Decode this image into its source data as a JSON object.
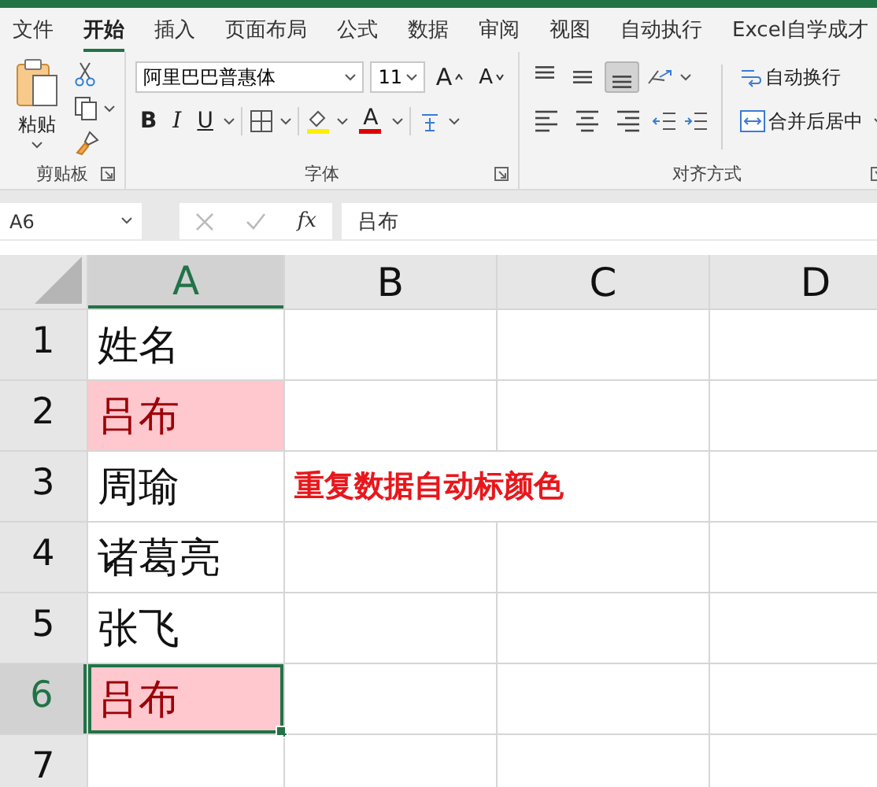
{
  "tabs": [
    {
      "label": "文件",
      "selected": false
    },
    {
      "label": "开始",
      "selected": true
    },
    {
      "label": "插入",
      "selected": false
    },
    {
      "label": "页面布局",
      "selected": false
    },
    {
      "label": "公式",
      "selected": false
    },
    {
      "label": "数据",
      "selected": false
    },
    {
      "label": "审阅",
      "selected": false
    },
    {
      "label": "视图",
      "selected": false
    },
    {
      "label": "自动执行",
      "selected": false
    },
    {
      "label": "Excel自学成才",
      "selected": false
    }
  ],
  "ribbon": {
    "clipboard": {
      "paste": "粘贴",
      "label": "剪贴板"
    },
    "font": {
      "name": "阿里巴巴普惠体",
      "size": "11",
      "grow": "A",
      "shrink": "A",
      "bold": "B",
      "italic": "I",
      "underline": "U",
      "font_color": "A",
      "label": "字体"
    },
    "alignment": {
      "vertical": [
        {
          "kind": "top",
          "selected": false
        },
        {
          "kind": "middle",
          "selected": false
        },
        {
          "kind": "bottom",
          "selected": true
        }
      ],
      "horizontal": [
        {
          "kind": "left",
          "selected": false
        },
        {
          "kind": "center",
          "selected": false
        },
        {
          "kind": "right",
          "selected": false
        }
      ],
      "wrap": "自动换行",
      "merge": "合并后居中",
      "label": "对齐方式"
    }
  },
  "formula_bar": {
    "name_box": "A6",
    "fx": "fx",
    "value": "吕布"
  },
  "sheet": {
    "columns": [
      {
        "label": "A",
        "selected": true
      },
      {
        "label": "B",
        "selected": false
      },
      {
        "label": "C",
        "selected": false
      },
      {
        "label": "D",
        "selected": false
      }
    ],
    "rows": [
      {
        "label": "1",
        "selected": false,
        "cells": [
          {
            "text": "姓名",
            "highlighted": false,
            "selected": false
          }
        ]
      },
      {
        "label": "2",
        "selected": false,
        "cells": [
          {
            "text": "吕布",
            "highlighted": true,
            "selected": false
          }
        ]
      },
      {
        "label": "3",
        "selected": false,
        "cells": [
          {
            "text": "周瑜",
            "highlighted": false,
            "selected": false
          }
        ],
        "note": "重复数据自动标颜色"
      },
      {
        "label": "4",
        "selected": false,
        "cells": [
          {
            "text": "诸葛亮",
            "highlighted": false,
            "selected": false
          }
        ]
      },
      {
        "label": "5",
        "selected": false,
        "cells": [
          {
            "text": "张飞",
            "highlighted": false,
            "selected": false
          }
        ]
      },
      {
        "label": "6",
        "selected": true,
        "cells": [
          {
            "text": "吕布",
            "highlighted": true,
            "selected": true
          }
        ]
      },
      {
        "label": "7",
        "selected": false,
        "cells": []
      }
    ]
  }
}
